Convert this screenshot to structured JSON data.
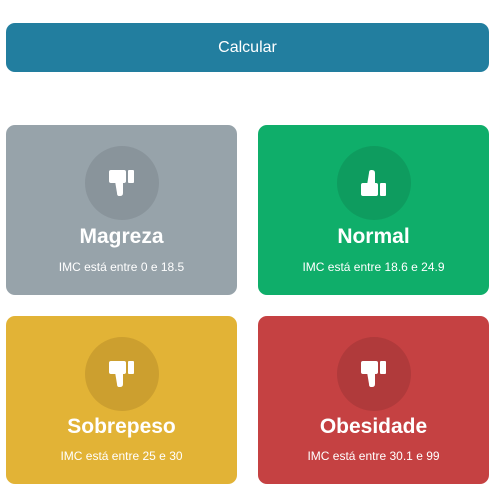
{
  "calculate_button": {
    "label": "Calcular"
  },
  "cards": [
    {
      "title": "Magreza",
      "prefix": "IMC está entre",
      "range": "0 e 18.5",
      "icon": "thumbs-down-icon",
      "color": "#97a3aa"
    },
    {
      "title": "Normal",
      "prefix": "IMC está entre",
      "range": "18.6 e 24.9",
      "icon": "thumbs-up-icon",
      "color": "#0fae6a"
    },
    {
      "title": "Sobrepeso",
      "prefix": "IMC está entre",
      "range": "25 e 30",
      "icon": "thumbs-down-icon",
      "color": "#e2b336"
    },
    {
      "title": "Obesidade",
      "prefix": "IMC está entre",
      "range": "30.1 e 99",
      "icon": "thumbs-down-icon",
      "color": "#c54142"
    }
  ]
}
